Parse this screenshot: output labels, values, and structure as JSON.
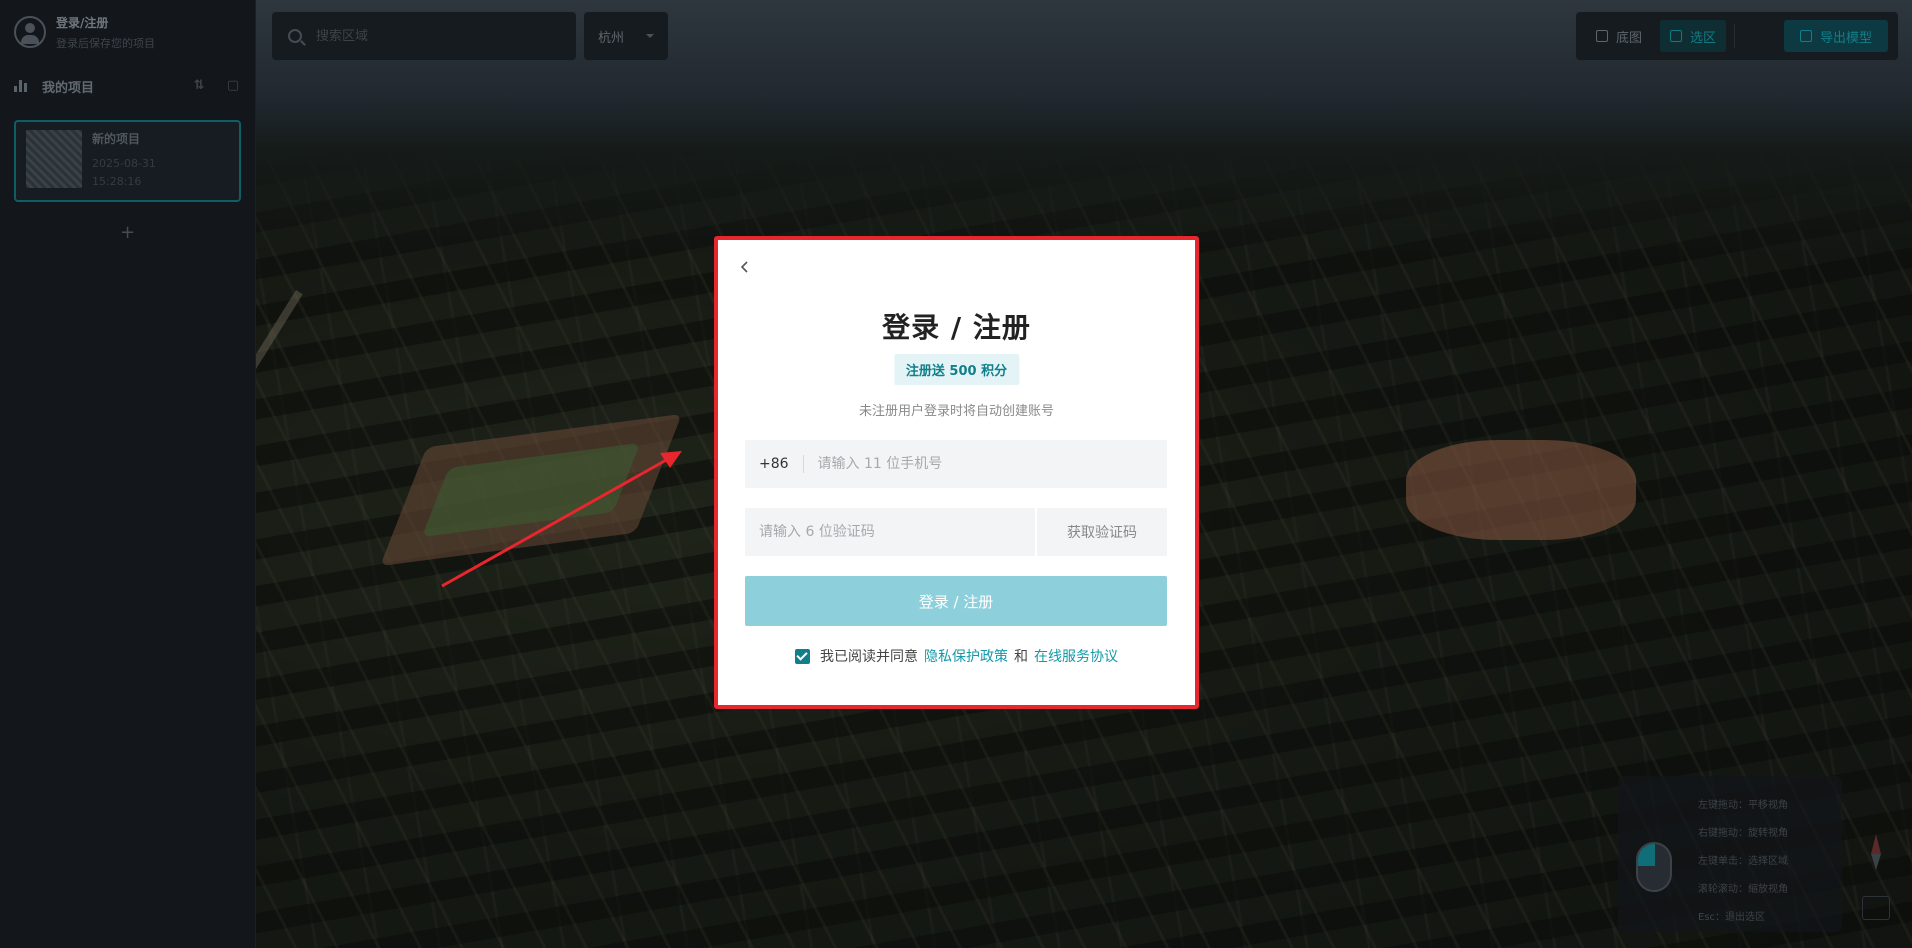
{
  "sidebar": {
    "user": {
      "login_label": "登录/注册",
      "hint": "登录后保存您的项目"
    },
    "projects_title": "我的项目",
    "project_card": {
      "name": "新的项目",
      "date": "2025-08-31",
      "time": "15:28:16"
    },
    "add_label": "+"
  },
  "topbar": {
    "search_placeholder": "搜索区域",
    "city": "杭州",
    "toolbar": {
      "view_label": "底图",
      "area_label": "选区",
      "export_label": "导出模型"
    }
  },
  "help_panel": {
    "lines": [
      "左键拖动：平移视角",
      "右键拖动：旋转视角",
      "左键单击：选择区域",
      "滚轮滚动：缩放视角",
      "Esc：退出选区"
    ]
  },
  "modal": {
    "title": "登录 / 注册",
    "promo": "注册送 500 积分",
    "subtitle": "未注册用户登录时将自动创建账号",
    "country_code": "+86",
    "phone_placeholder": "请输入 11 位手机号",
    "code_placeholder": "请输入 6 位验证码",
    "get_code_label": "获取验证码",
    "submit_label": "登录 / 注册",
    "agree_prefix": "我已阅读并同意",
    "privacy_link": "隐私保护政策",
    "and_text": "和",
    "service_link": "在线服务协议"
  },
  "colors": {
    "accent": "#1399a8",
    "submit_bg": "#8ecfdc",
    "annotation_red": "#e8262e"
  }
}
